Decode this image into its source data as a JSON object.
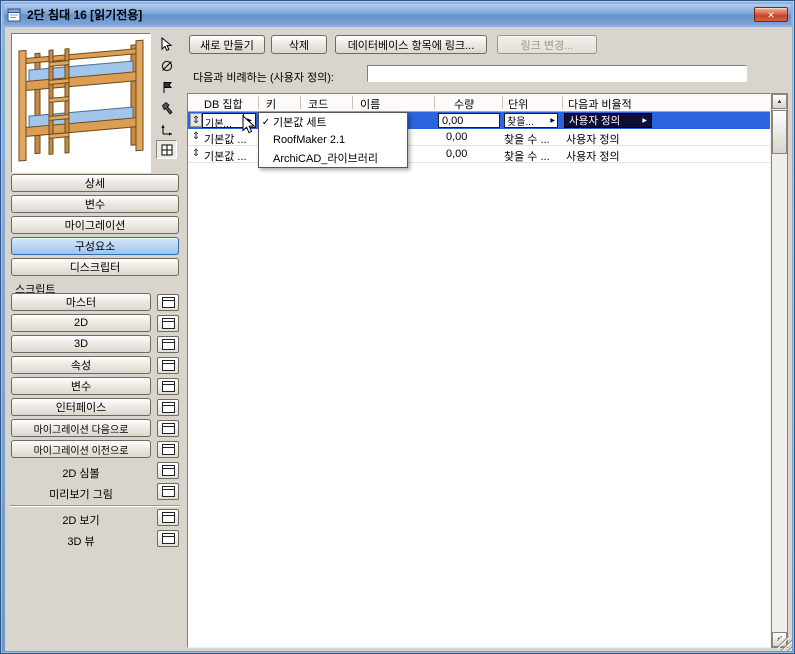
{
  "window": {
    "title": "2단 침대 16 [읽기전용]",
    "close_glyph": "✕"
  },
  "glyphs": {
    "right": "▶",
    "up": "▲",
    "down": "▼",
    "updown": "⇕",
    "check": "✓"
  },
  "sidebar": {
    "tools": [
      "cursor",
      "circle-slash",
      "flag",
      "hammer",
      "axes",
      "grid"
    ],
    "sections": [
      {
        "label": "상세"
      },
      {
        "label": "변수"
      },
      {
        "label": "마이그레이션"
      },
      {
        "label": "구성요소"
      },
      {
        "label": "디스크립터"
      }
    ],
    "selected_section": "구성요소",
    "script_header": "스크립트",
    "scripts": [
      {
        "label": "마스터"
      },
      {
        "label": "2D"
      },
      {
        "label": "3D"
      },
      {
        "label": "속성"
      },
      {
        "label": "변수"
      },
      {
        "label": "인터페이스"
      },
      {
        "label": "마이그레이션 다음으로"
      },
      {
        "label": "마이그레이션 이전으로"
      }
    ],
    "extras": [
      {
        "label": "2D 심볼"
      },
      {
        "label": "미리보기 그림"
      }
    ],
    "views": [
      {
        "label": "2D 보기"
      },
      {
        "label": "3D 뷰"
      }
    ]
  },
  "actions": {
    "new": "새로 만들기",
    "delete": "삭제",
    "link_db": "데이터베이스 항목에 링크...",
    "change_link": "링크 변경..."
  },
  "proportional": {
    "label": "다음과 비례하는 (사용자 정의):",
    "value": ""
  },
  "components_table": {
    "headers": [
      "DB 집합",
      "키",
      "코드",
      "이름",
      "수량",
      "단위",
      "다음과 비율적"
    ],
    "rows": [
      {
        "db": "기본...",
        "qty": "0,00",
        "unit": "찾을...",
        "ratio": "사용자 정의"
      },
      {
        "db": "기본값 ...",
        "qty": "0,00",
        "unit": "찾을 수 ...",
        "ratio": "사용자 정의"
      },
      {
        "db": "기본값 ...",
        "qty": "0,00",
        "unit": "찾을 수 ...",
        "ratio": "사용자 정의"
      }
    ]
  },
  "db_menu": {
    "items": [
      {
        "label": "기본값 세트",
        "checked": true
      },
      {
        "label": "RoofMaker 2.1",
        "checked": false
      },
      {
        "label": "ArchiCAD_라이브러리",
        "checked": false
      }
    ]
  },
  "colors": {
    "selection": "#2d64dd",
    "custom_button": "#0e0e38",
    "titlebar": "#7da6d8"
  }
}
